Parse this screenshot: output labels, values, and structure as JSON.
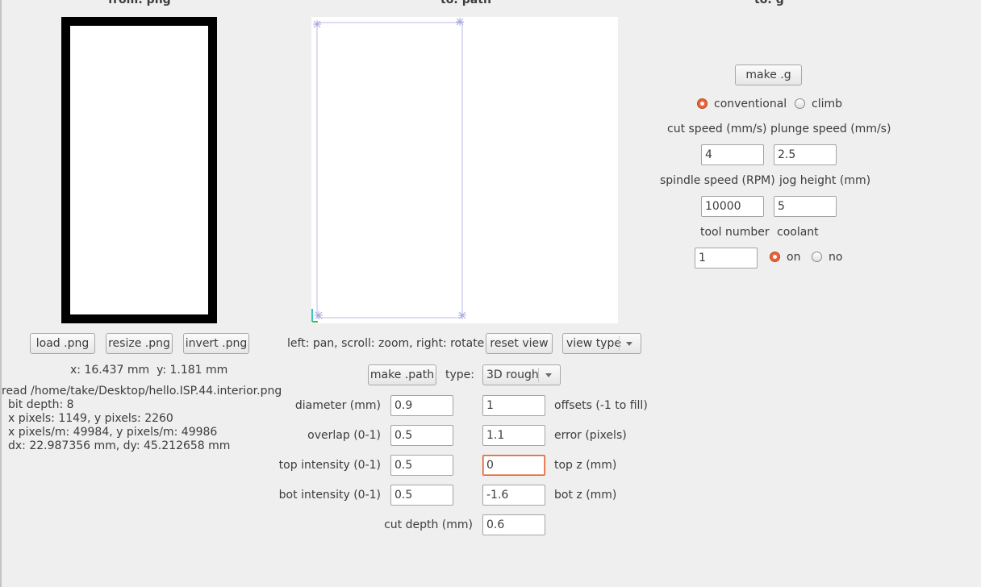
{
  "titles": {
    "from": "from: png",
    "path": "to: path",
    "g": "to: g"
  },
  "png_panel": {
    "buttons": {
      "load": "load .png",
      "resize": "resize .png",
      "invert": "invert .png"
    },
    "coords": "x: 16.437 mm  y: 1.181 mm",
    "info": {
      "read": "read /home/take/Desktop/hello.ISP.44.interior.png",
      "bit_depth": "bit depth: 8",
      "pixels": "x pixels: 1149, y pixels: 2260",
      "pixels_per_m": "x pixels/m: 49984, y pixels/m: 49986",
      "dx_dy": "dx: 22.987356 mm, dy: 45.212658 mm"
    }
  },
  "path_panel": {
    "view_hint": "left: pan, scroll: zoom, right: rotate",
    "reset_view": "reset view",
    "view_type": "view type",
    "make_path": "make .path",
    "type_label": "type:",
    "type_value": "3D rough",
    "params": {
      "diameter": {
        "label": "diameter (mm)",
        "value": "0.9"
      },
      "overlap": {
        "label": "overlap (0-1)",
        "value": "0.5"
      },
      "top_intensity": {
        "label": "top intensity (0-1)",
        "value": "0.5"
      },
      "bot_intensity": {
        "label": "bot intensity (0-1)",
        "value": "0.5"
      },
      "cut_depth": {
        "label": "cut depth (mm)",
        "value": "0.6"
      },
      "offsets": {
        "label": "offsets (-1 to fill)",
        "value": "1"
      },
      "error": {
        "label": "error (pixels)",
        "value": "1.1"
      },
      "top_z": {
        "label": "top z (mm)",
        "value": "0"
      },
      "bot_z": {
        "label": "bot z (mm)",
        "value": "-1.6"
      }
    }
  },
  "g_panel": {
    "make_g": "make .g",
    "direction": {
      "conventional": "conventional",
      "climb": "climb",
      "selected": "conventional"
    },
    "cut_speed": {
      "label": "cut speed (mm/s)",
      "value": "4"
    },
    "plunge_speed": {
      "label": "plunge speed (mm/s)",
      "value": "2.5"
    },
    "spindle_speed": {
      "label": "spindle speed (RPM)",
      "value": "10000"
    },
    "jog_height": {
      "label": "jog height (mm)",
      "value": "5"
    },
    "tool_number": {
      "label": "tool number",
      "value": "1"
    },
    "coolant": {
      "label": "coolant",
      "on": "on",
      "no": "no",
      "selected": "on"
    }
  },
  "colors": {
    "background": "#efefef",
    "accent": "#e8643a",
    "path_line": "#b8b8e6"
  }
}
